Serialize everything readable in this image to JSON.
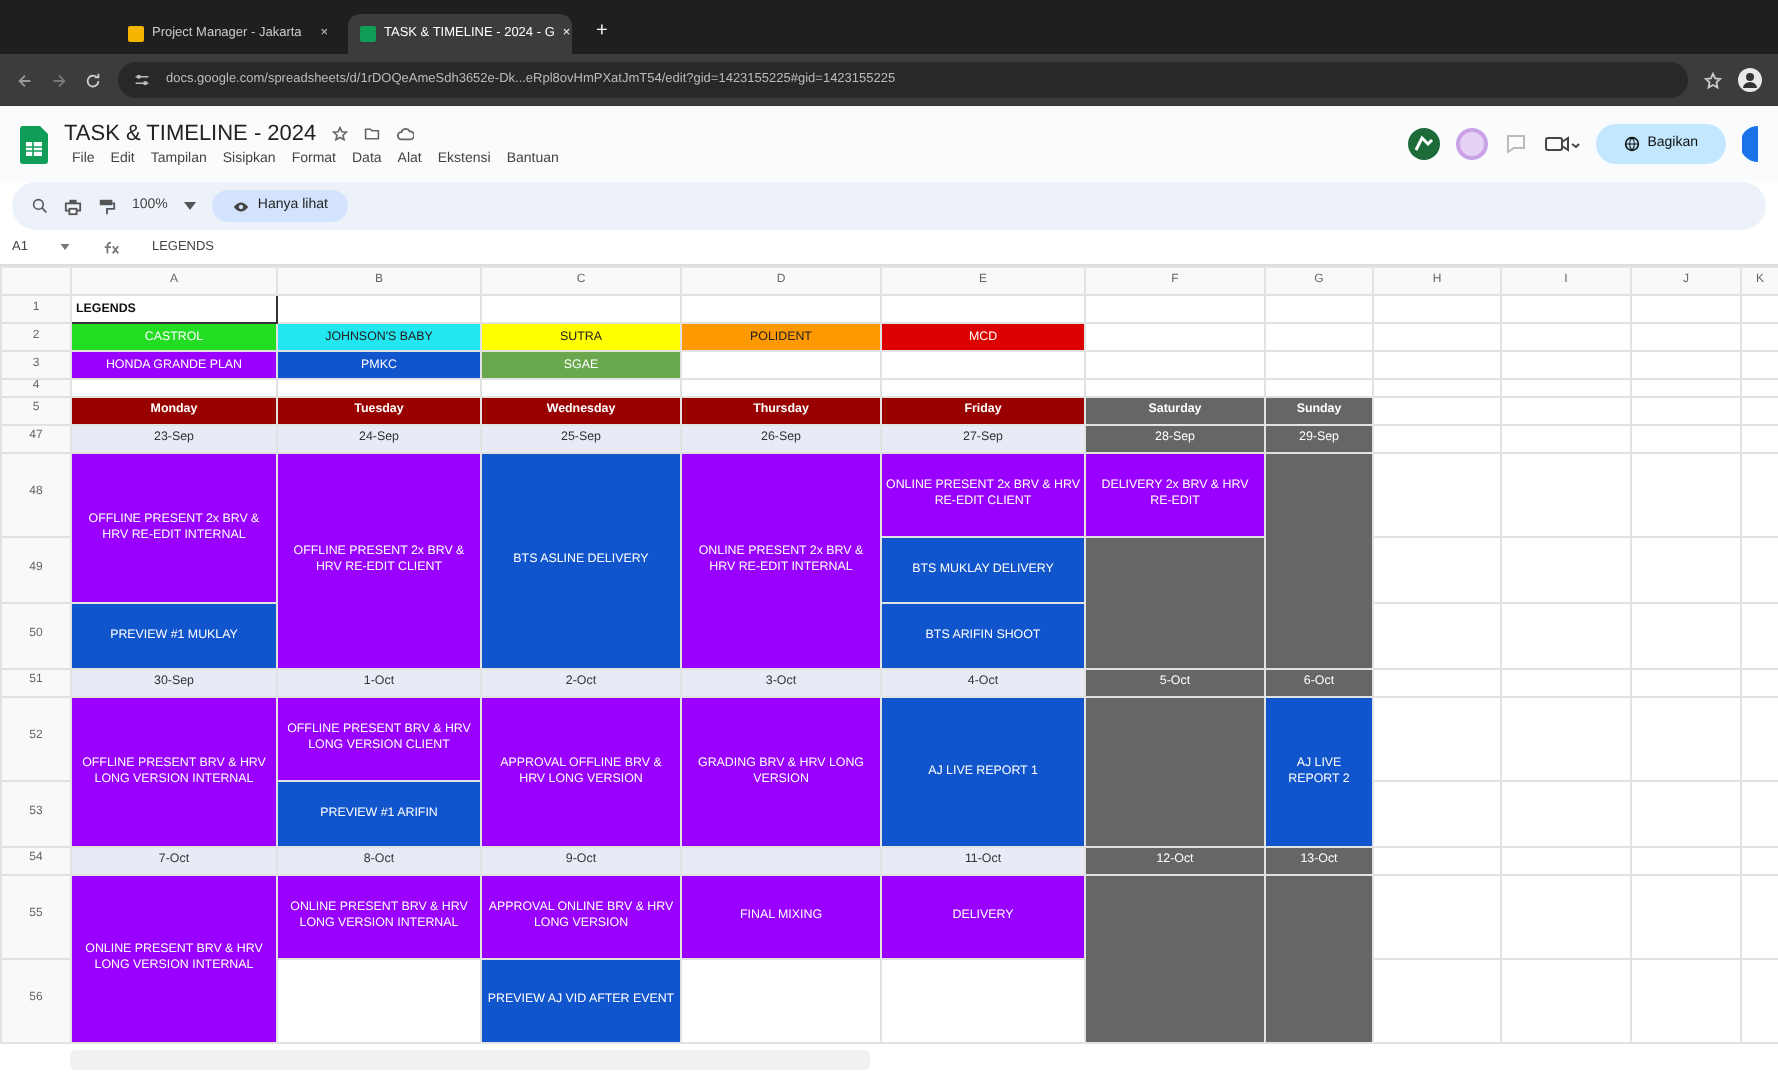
{
  "browser": {
    "tabs": [
      {
        "title": "Project Manager - Jakarta",
        "close": "×",
        "selected": false
      },
      {
        "title": "TASK & TIMELINE - 2024 - G",
        "close": "×",
        "selected": true
      }
    ],
    "new_tab": "+",
    "url": "docs.google.com/spreadsheets/d/1rDOQeAmeSdh3652e-Dk...eRpl8ovHmPXatJmT54/edit?gid=1423155225#gid=1423155225"
  },
  "document": {
    "title": "TASK & TIMELINE - 2024",
    "menu": [
      "File",
      "Edit",
      "Tampilan",
      "Sisipkan",
      "Format",
      "Data",
      "Alat",
      "Ekstensi",
      "Bantuan"
    ],
    "share": "Bagikan"
  },
  "toolbar": {
    "zoom": "100%",
    "view_mode": "Hanya lihat"
  },
  "formula_bar": {
    "cell": "A1",
    "content": "LEGENDS"
  },
  "column_headers": [
    "A",
    "B",
    "C",
    "D",
    "E",
    "F",
    "G",
    "H",
    "I",
    "J",
    "K"
  ],
  "rows": [
    {
      "number": "1",
      "cells": [
        {
          "kind": "label",
          "text": "LEGENDS"
        }
      ]
    },
    {
      "number": "2",
      "cells": [
        {
          "kind": "legend",
          "text": "CASTROL",
          "color": "#22dd22"
        },
        {
          "kind": "legend",
          "text": "JOHNSON'S BABY",
          "color": "#22e6f0"
        },
        {
          "kind": "legend",
          "text": "SUTRA",
          "color": "#ffff00"
        },
        {
          "kind": "legend",
          "text": "POLIDENT",
          "color": "#ff9900"
        },
        {
          "kind": "legend",
          "text": "MCD",
          "color": "#dd0000"
        }
      ]
    },
    {
      "number": "3",
      "cells": [
        {
          "kind": "legend",
          "text": "HONDA GRANDE PLAN",
          "color": "#9900ff"
        },
        {
          "kind": "legend",
          "text": "PMKC",
          "color": "#1155cc"
        },
        {
          "kind": "legend",
          "text": "SGAE",
          "color": "#6aa84f"
        }
      ]
    },
    {
      "number": "4",
      "cells": []
    },
    {
      "number": "5",
      "cells": [
        {
          "kind": "day",
          "text": "Monday",
          "color": "#990000"
        },
        {
          "kind": "day",
          "text": "Tuesday",
          "color": "#990000"
        },
        {
          "kind": "day",
          "text": "Wednesday",
          "color": "#990000"
        },
        {
          "kind": "day",
          "text": "Thursday",
          "color": "#990000"
        },
        {
          "kind": "day",
          "text": "Friday",
          "color": "#990000"
        },
        {
          "kind": "day",
          "text": "Saturday",
          "color": "#666666"
        },
        {
          "kind": "day",
          "text": "Sunday",
          "color": "#666666"
        }
      ]
    },
    {
      "number": "47",
      "cells": [
        {
          "kind": "date",
          "text": "23-Sep"
        },
        {
          "kind": "date",
          "text": "24-Sep"
        },
        {
          "kind": "date",
          "text": "25-Sep"
        },
        {
          "kind": "date",
          "text": "26-Sep"
        },
        {
          "kind": "date",
          "text": "27-Sep"
        },
        {
          "kind": "date",
          "text": "28-Sep",
          "color": "#666666"
        },
        {
          "kind": "date",
          "text": "29-Sep",
          "color": "#666666"
        }
      ]
    },
    {
      "number": "48",
      "cells": [
        {
          "kind": "task",
          "text": "OFFLINE PRESENT 2x BRV & HRV RE-EDIT INTERNAL",
          "color": "#9900ff"
        },
        {
          "kind": "task",
          "text": "OFFLINE PRESENT 2x BRV & HRV RE-EDIT CLIENT",
          "color": "#9900ff"
        },
        {
          "kind": "task",
          "text": "BTS ASLINE DELIVERY",
          "color": "#1155cc"
        },
        {
          "kind": "task",
          "text": "ONLINE PRESENT 2x BRV & HRV RE-EDIT INTERNAL",
          "color": "#9900ff"
        },
        {
          "kind": "task",
          "text": "ONLINE PRESENT 2x BRV & HRV RE-EDIT CLIENT",
          "color": "#9900ff"
        },
        {
          "kind": "task",
          "text": "DELIVERY 2x BRV & HRV RE-EDIT",
          "color": "#9900ff"
        },
        {
          "kind": "task",
          "color": "#666666"
        }
      ]
    },
    {
      "number": "49",
      "cells": [
        {
          "kind": "task",
          "text": "BTS MUKLAY DELIVERY",
          "color": "#1155cc"
        },
        {
          "kind": "task",
          "color": "#666666"
        }
      ]
    },
    {
      "number": "50",
      "cells": [
        {
          "kind": "task",
          "text": "PREVIEW #1 MUKLAY",
          "color": "#1155cc"
        },
        {
          "kind": "task",
          "text": "BTS ARIFIN SHOOT",
          "color": "#1155cc"
        }
      ]
    },
    {
      "number": "51",
      "cells": [
        {
          "kind": "date",
          "text": "30-Sep"
        },
        {
          "kind": "date",
          "text": "1-Oct"
        },
        {
          "kind": "date",
          "text": "2-Oct"
        },
        {
          "kind": "date",
          "text": "3-Oct"
        },
        {
          "kind": "date",
          "text": "4-Oct"
        },
        {
          "kind": "date",
          "text": "5-Oct",
          "color": "#666666"
        },
        {
          "kind": "date",
          "text": "6-Oct",
          "color": "#666666"
        }
      ]
    },
    {
      "number": "52",
      "cells": [
        {
          "kind": "task",
          "text": "OFFLINE PRESENT BRV & HRV LONG VERSION INTERNAL",
          "color": "#9900ff"
        },
        {
          "kind": "task",
          "text": "OFFLINE PRESENT BRV & HRV LONG VERSION CLIENT",
          "color": "#9900ff"
        },
        {
          "kind": "task",
          "text": "APPROVAL OFFLINE BRV & HRV LONG VERSION",
          "color": "#9900ff"
        },
        {
          "kind": "task",
          "text": "GRADING BRV & HRV LONG VERSION",
          "color": "#9900ff"
        },
        {
          "kind": "task",
          "text": "AJ LIVE REPORT 1",
          "color": "#1155cc"
        },
        {
          "kind": "task",
          "color": "#666666"
        },
        {
          "kind": "task",
          "text": "AJ LIVE REPORT 2",
          "color": "#1155cc"
        }
      ]
    },
    {
      "number": "53",
      "cells": [
        {
          "kind": "task",
          "text": "PREVIEW #1 ARIFIN",
          "color": "#1155cc"
        }
      ]
    },
    {
      "number": "54",
      "cells": [
        {
          "kind": "date",
          "text": "7-Oct"
        },
        {
          "kind": "date",
          "text": "8-Oct"
        },
        {
          "kind": "date",
          "text": "9-Oct"
        },
        {
          "kind": "date"
        },
        {
          "kind": "date",
          "text": "11-Oct"
        },
        {
          "kind": "date",
          "text": "12-Oct",
          "color": "#666666"
        },
        {
          "kind": "date",
          "text": "13-Oct",
          "color": "#666666"
        }
      ]
    },
    {
      "number": "55",
      "cells": [
        {
          "kind": "task",
          "text": "ONLINE PRESENT BRV & HRV LONG VERSION INTERNAL",
          "color": "#9900ff"
        },
        {
          "kind": "task",
          "text": "ONLINE PRESENT BRV & HRV LONG VERSION INTERNAL",
          "color": "#9900ff"
        },
        {
          "kind": "task",
          "text": "APPROVAL ONLINE BRV & HRV LONG VERSION",
          "color": "#9900ff"
        },
        {
          "kind": "task",
          "text": "FINAL MIXING",
          "color": "#9900ff"
        },
        {
          "kind": "task",
          "text": "DELIVERY",
          "color": "#9900ff"
        },
        {
          "kind": "task",
          "color": "#666666"
        },
        {
          "kind": "task",
          "color": "#666666"
        }
      ]
    },
    {
      "number": "56",
      "cells": [
        {
          "kind": "blank"
        },
        {
          "kind": "task",
          "text": "PREVIEW AJ VID AFTER EVENT",
          "color": "#1155cc"
        }
      ]
    }
  ]
}
